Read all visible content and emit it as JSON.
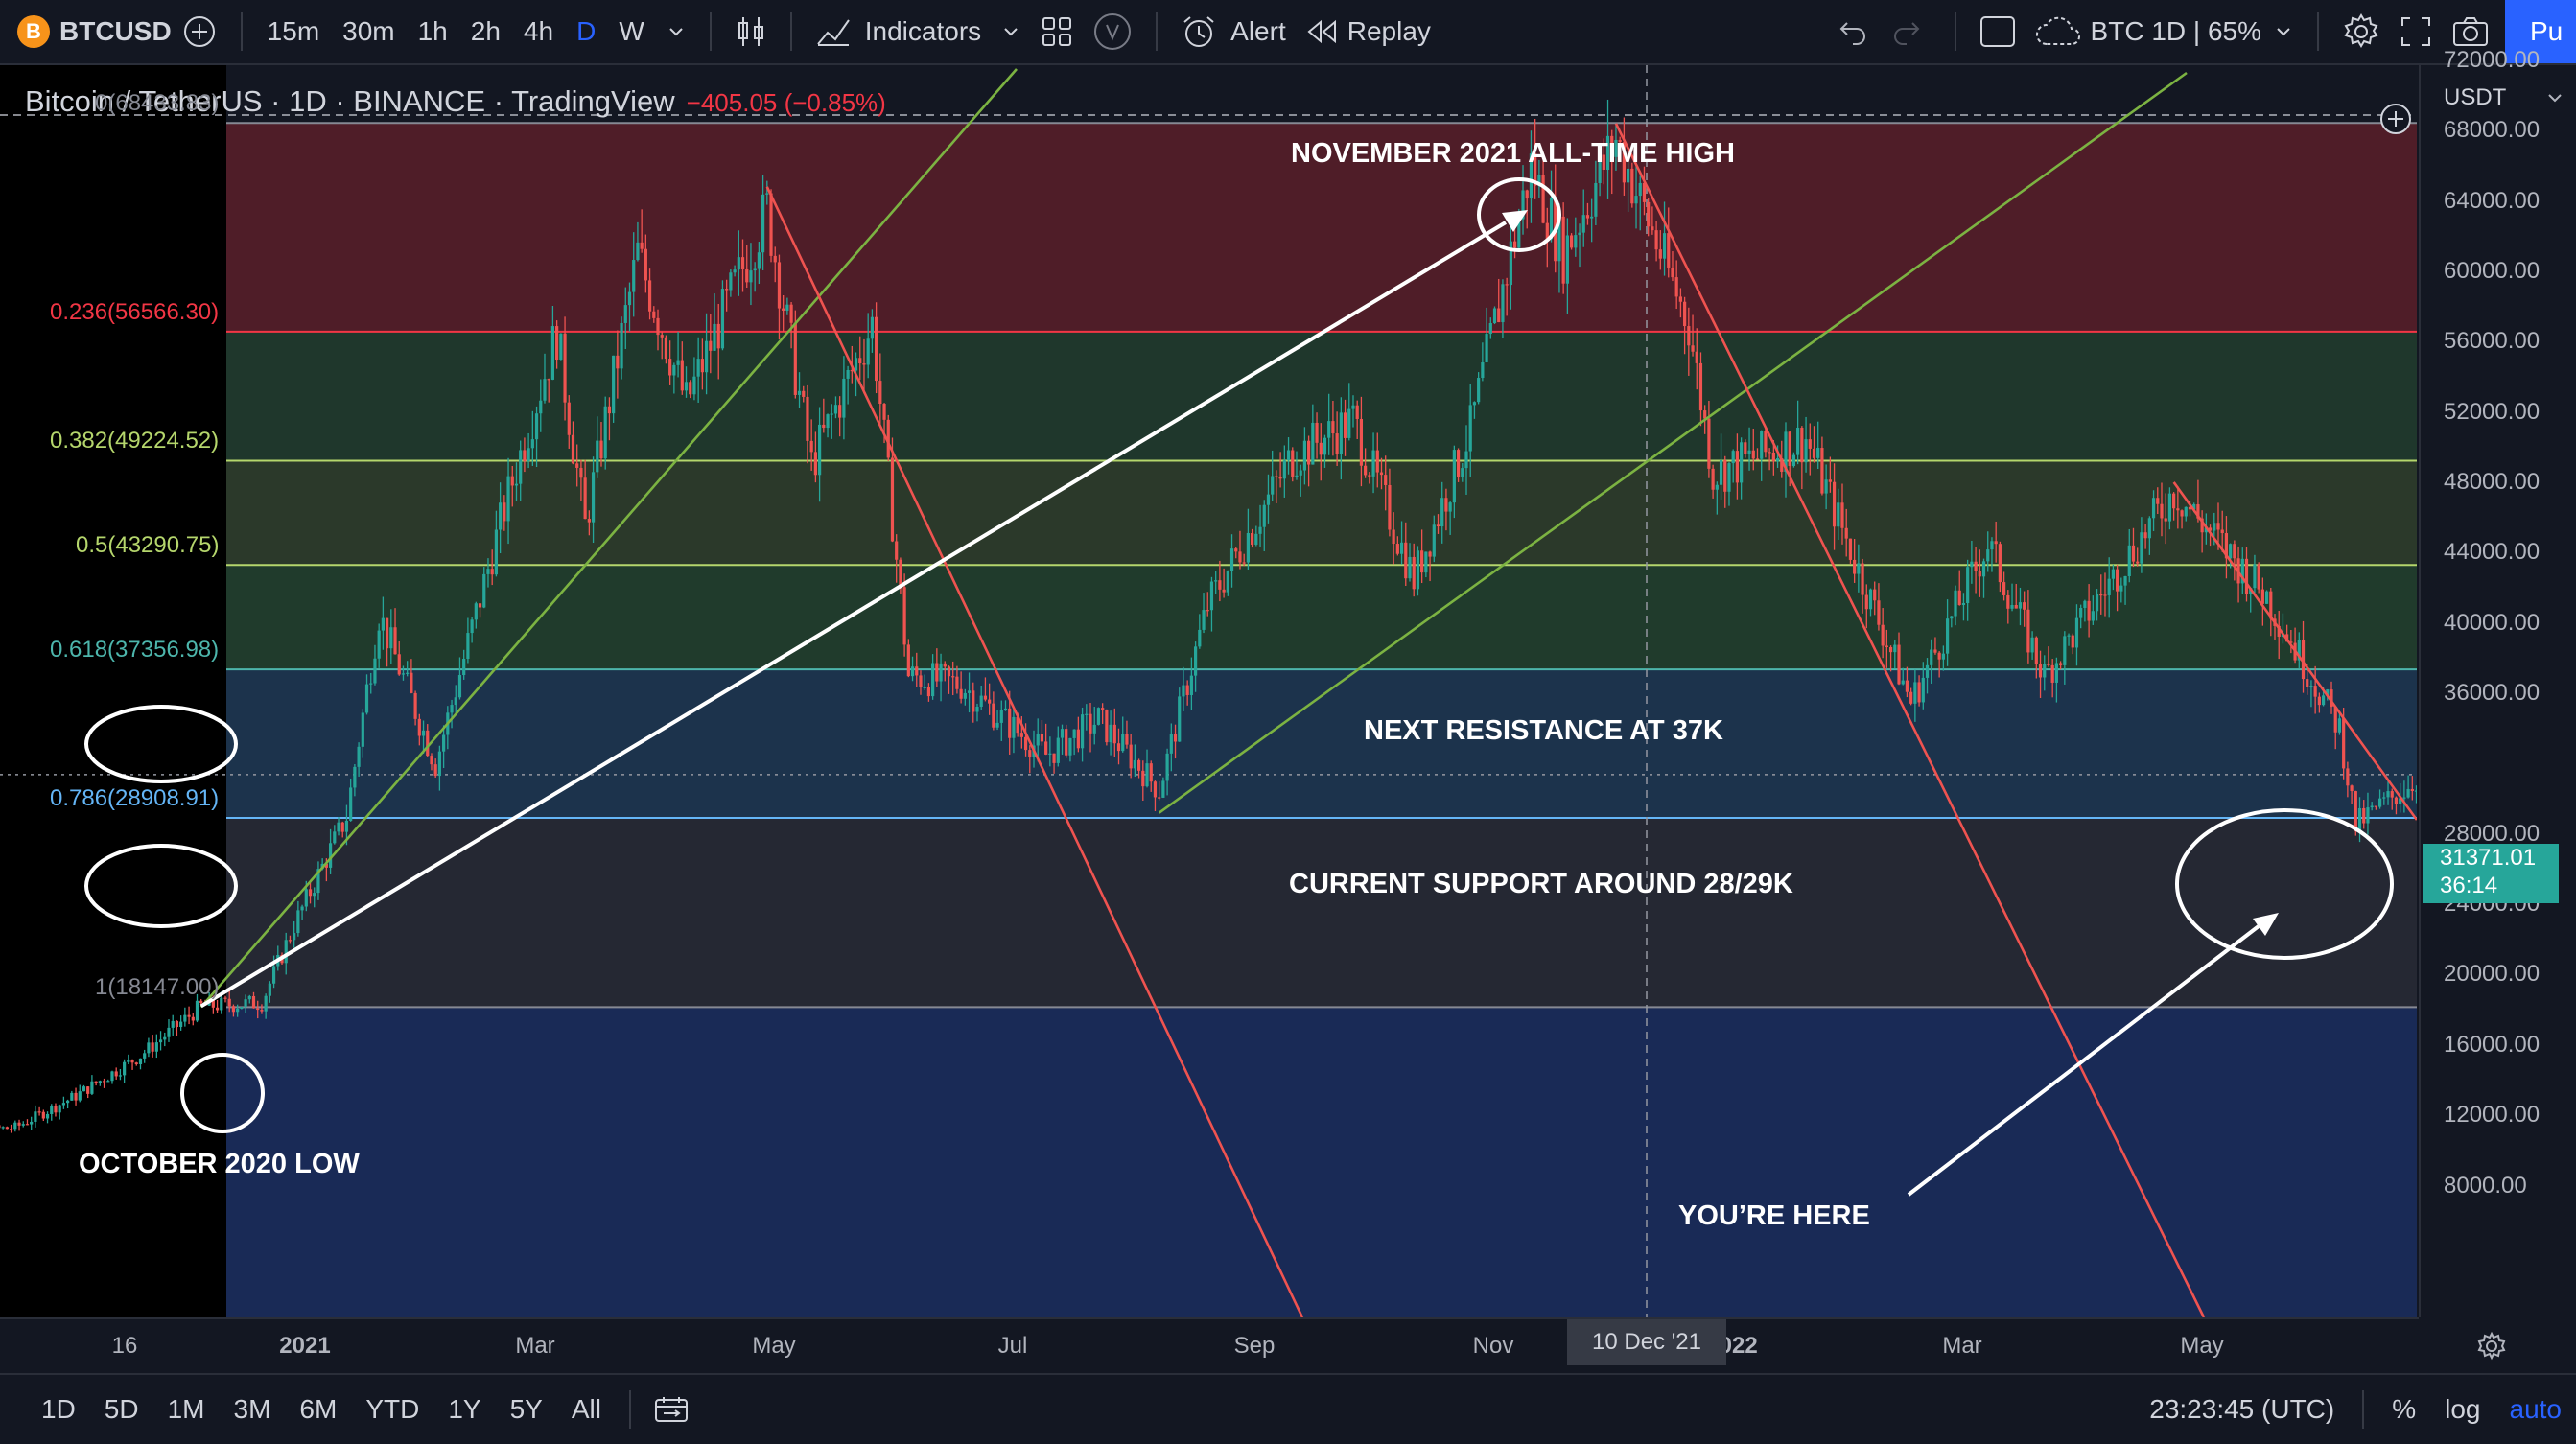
{
  "toolbar": {
    "symbol_icon": "B",
    "symbol": "BTCUSD",
    "intervals": [
      "15m",
      "30m",
      "1h",
      "2h",
      "4h",
      "D",
      "W"
    ],
    "active_interval": "D",
    "indicators_label": "Indicators",
    "alert_label": "Alert",
    "replay_label": "Replay",
    "layout_label": "BTC 1D | 65%",
    "publish_label": "Pu"
  },
  "legend": {
    "title": "Bitcoin / TetherUS · 1D · BINANCE · TradingView",
    "change": "−405.05 (−0.85%)"
  },
  "fib_levels": [
    {
      "label": "0(68433.83)",
      "color": "#868993"
    },
    {
      "label": "0.236(56566.30)",
      "color": "#f23645"
    },
    {
      "label": "0.382(49224.52)",
      "color": "#b5d66c"
    },
    {
      "label": "0.5(43290.75)",
      "color": "#b5d66c"
    },
    {
      "label": "0.618(37356.98)",
      "color": "#4db6ac"
    },
    {
      "label": "0.786(28908.91)",
      "color": "#64b5f6"
    },
    {
      "label": "1(18147.00)",
      "color": "#868993"
    }
  ],
  "annotations": {
    "ath": "NOVEMBER 2021 ALL-TIME HIGH",
    "resistance": "NEXT RESISTANCE AT 37K",
    "support": "CURRENT SUPPORT AROUND 28/29K",
    "low": "OCTOBER 2020 LOW",
    "here": "YOU’RE HERE"
  },
  "yaxis": {
    "currency": "USDT",
    "labels": [
      "72000.00",
      "68000.00",
      "64000.00",
      "60000.00",
      "56000.00",
      "52000.00",
      "48000.00",
      "44000.00",
      "40000.00",
      "36000.00",
      "28000.00",
      "24000.00",
      "20000.00",
      "16000.00",
      "12000.00",
      "8000.00"
    ],
    "last_price": "31371.01",
    "countdown": "36:14"
  },
  "xaxis": {
    "labels": [
      "16",
      "2021",
      "Mar",
      "May",
      "Jul",
      "Sep",
      "Nov",
      "2022",
      "Mar",
      "May"
    ],
    "cursor_label": "10 Dec '21"
  },
  "bottombar": {
    "ranges": [
      "1D",
      "5D",
      "1M",
      "3M",
      "6M",
      "YTD",
      "1Y",
      "5Y",
      "All"
    ],
    "clock": "23:23:45 (UTC)",
    "pct": "%",
    "log": "log",
    "auto": "auto"
  },
  "chart_data": {
    "type": "candlestick",
    "symbol": "BTCUSDT",
    "ylim": [
      6000,
      74000
    ],
    "price_points": [
      [
        "2020-09-20",
        10900
      ],
      [
        "2020-10-10",
        11300
      ],
      [
        "2020-10-25",
        13100
      ],
      [
        "2020-11-10",
        15400
      ],
      [
        "2020-11-25",
        18200
      ],
      [
        "2020-12-10",
        18400
      ],
      [
        "2020-12-18",
        22800
      ],
      [
        "2020-12-31",
        29000
      ],
      [
        "2021-01-08",
        40500
      ],
      [
        "2021-01-22",
        32000
      ],
      [
        "2021-02-08",
        46500
      ],
      [
        "2021-02-21",
        56500
      ],
      [
        "2021-02-28",
        45500
      ],
      [
        "2021-03-13",
        61000
      ],
      [
        "2021-03-25",
        52500
      ],
      [
        "2021-04-14",
        63500
      ],
      [
        "2021-04-25",
        49000
      ],
      [
        "2021-05-10",
        57000
      ],
      [
        "2021-05-19",
        37000
      ],
      [
        "2021-06-01",
        36500
      ],
      [
        "2021-06-22",
        32500
      ],
      [
        "2021-07-05",
        34500
      ],
      [
        "2021-07-20",
        30500
      ],
      [
        "2021-08-01",
        41000
      ],
      [
        "2021-08-22",
        49500
      ],
      [
        "2021-09-06",
        51500
      ],
      [
        "2021-09-21",
        42500
      ],
      [
        "2021-10-05",
        51000
      ],
      [
        "2021-10-20",
        66000
      ],
      [
        "2021-10-28",
        61000
      ],
      [
        "2021-11-10",
        67500
      ],
      [
        "2021-11-28",
        57000
      ],
      [
        "2021-12-04",
        48500
      ],
      [
        "2021-12-27",
        50500
      ],
      [
        "2022-01-22",
        35500
      ],
      [
        "2022-02-10",
        44500
      ],
      [
        "2022-02-24",
        37000
      ],
      [
        "2022-03-28",
        47500
      ],
      [
        "2022-04-20",
        41500
      ],
      [
        "2022-05-08",
        34000
      ],
      [
        "2022-05-12",
        28500
      ],
      [
        "2022-05-31",
        31800
      ],
      [
        "2022-06-05",
        31371
      ]
    ],
    "fibonacci_retracement": {
      "high": 68433.83,
      "low": 18147.0,
      "levels": [
        {
          "ratio": 0,
          "price": 68433.83
        },
        {
          "ratio": 0.236,
          "price": 56566.3
        },
        {
          "ratio": 0.382,
          "price": 49224.52
        },
        {
          "ratio": 0.5,
          "price": 43290.75
        },
        {
          "ratio": 0.618,
          "price": 37356.98
        },
        {
          "ratio": 0.786,
          "price": 28908.91
        },
        {
          "ratio": 1,
          "price": 18147.0
        }
      ]
    },
    "last_price": 31371.01
  }
}
